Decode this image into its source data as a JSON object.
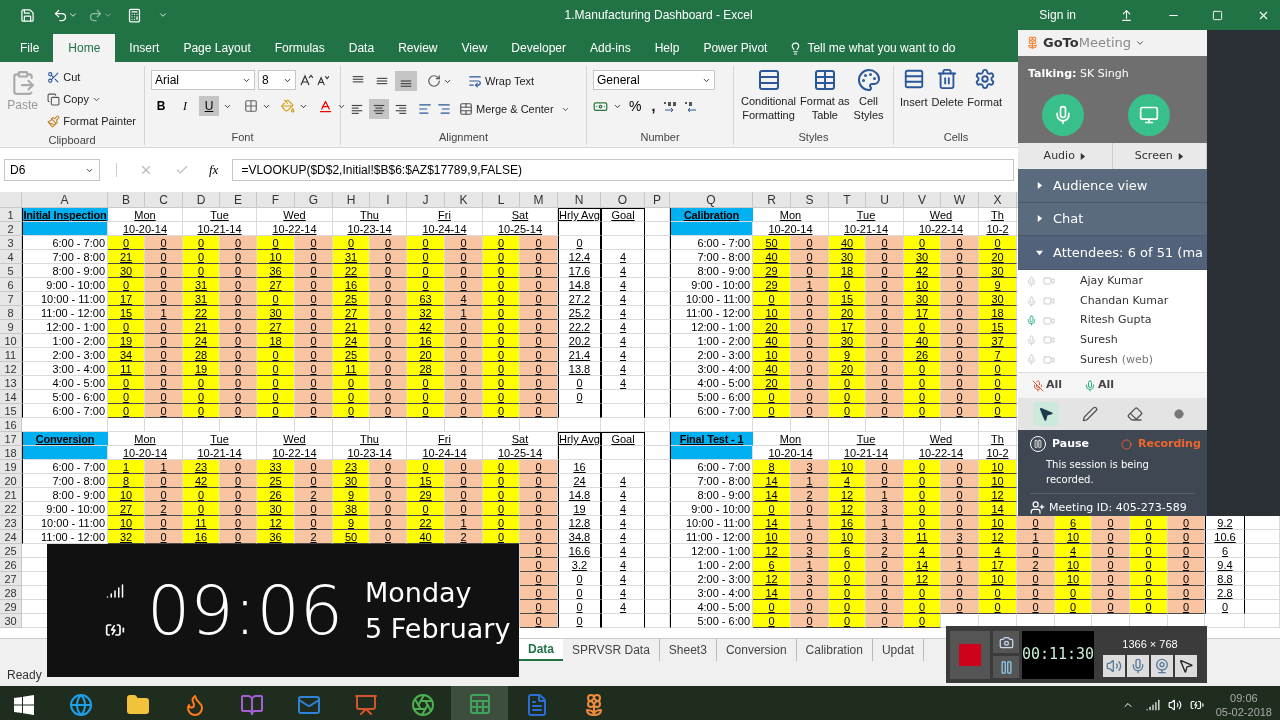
{
  "title_bar": {
    "title": "1.Manufacturing Dashboard  -  Excel",
    "sign_in": "Sign in"
  },
  "ribbon_tabs": [
    {
      "label": "File",
      "selected": false
    },
    {
      "label": "Home",
      "selected": true
    },
    {
      "label": "Insert",
      "selected": false
    },
    {
      "label": "Page Layout",
      "selected": false
    },
    {
      "label": "Formulas",
      "selected": false
    },
    {
      "label": "Data",
      "selected": false
    },
    {
      "label": "Review",
      "selected": false
    },
    {
      "label": "View",
      "selected": false
    },
    {
      "label": "Developer",
      "selected": false
    },
    {
      "label": "Add-ins",
      "selected": false
    },
    {
      "label": "Help",
      "selected": false
    },
    {
      "label": "Power Pivot",
      "selected": false
    }
  ],
  "tell_me": "Tell me what you want to do",
  "ribbon": {
    "clipboard": {
      "paste": "Paste",
      "cut": "Cut",
      "copy": "Copy",
      "format_painter": "Format Painter",
      "label": "Clipboard"
    },
    "font": {
      "name": "Arial",
      "size": "8",
      "buttons": [
        {
          "label": "B",
          "on": false
        },
        {
          "label": "I",
          "on": false
        },
        {
          "label": "U",
          "on": true
        }
      ],
      "label": "Font"
    },
    "alignment": {
      "buttons": [
        {
          "kind": "top",
          "on": false
        },
        {
          "kind": "middle",
          "on": false
        },
        {
          "kind": "bottom",
          "on": true
        },
        {
          "kind": "left",
          "on": false
        },
        {
          "kind": "center",
          "on": true
        },
        {
          "kind": "right",
          "on": false
        }
      ],
      "wrap_text": "Wrap Text",
      "merge_center": "Merge & Center",
      "label": "Alignment"
    },
    "number": {
      "format": "General",
      "percent": "%",
      "comma": ",",
      "label": "Number"
    },
    "styles": {
      "buttons": [
        {
          "kind": "conditional",
          "lines": [
            "Conditional",
            "Formatting"
          ]
        },
        {
          "kind": "table",
          "lines": [
            "Format as",
            "Table"
          ]
        },
        {
          "kind": "cell",
          "lines": [
            "Cell",
            "Styles"
          ]
        }
      ],
      "label": "Styles"
    },
    "cells": {
      "buttons": [
        {
          "kind": "insert",
          "label": "Insert"
        },
        {
          "kind": "delete",
          "label": "Delete"
        },
        {
          "kind": "format",
          "label": "Format"
        }
      ],
      "label": "Cells"
    }
  },
  "formula_bar": {
    "name_box": "D6",
    "fx": "fx",
    "formula": "=VLOOKUP($D$2,Initial!$B$6:$AZ$17789,9,FALSE)"
  },
  "sheet": {
    "column_headers": [
      "A",
      "B",
      "C",
      "D",
      "E",
      "F",
      "G",
      "H",
      "I",
      "J",
      "K",
      "L",
      "M",
      "N",
      "O",
      "P",
      "Q",
      "R",
      "S",
      "T",
      "U",
      "V",
      "W",
      "X"
    ],
    "row_numbers": [
      "1",
      "2",
      "3",
      "4",
      "5",
      "6",
      "7",
      "8",
      "9",
      "10",
      "11",
      "12",
      "13",
      "14",
      "15",
      "16",
      "17",
      "18",
      "19",
      "20",
      "21",
      "22",
      "23",
      "24",
      "25",
      "26",
      "27",
      "28",
      "29",
      "30"
    ],
    "tables": [
      {
        "title": "Initial Inspection",
        "days": [
          {
            "day": "Mon",
            "date": "10-20-14"
          },
          {
            "day": "Tue",
            "date": "10-21-14"
          },
          {
            "day": "Wed",
            "date": "10-22-14"
          },
          {
            "day": "Thu",
            "date": "10-23-14"
          },
          {
            "day": "Fri",
            "date": "10-24-14"
          },
          {
            "day": "Sat",
            "date": "10-25-14"
          }
        ],
        "hourly_avg_label": "Hrly Avg",
        "goal_label": "Goal",
        "rows": [
          {
            "time": "6:00 - 7:00",
            "values": [
              "0",
              "0",
              "0",
              "0",
              "0",
              "0",
              "0",
              "0",
              "0",
              "0",
              "0",
              "0"
            ],
            "hrly_avg": "0"
          },
          {
            "time": "7:00 - 8:00",
            "values": [
              "21",
              "0",
              "0",
              "0",
              "10",
              "0",
              "31",
              "0",
              "0",
              "0",
              "0",
              "0"
            ],
            "hrly_avg": "12.4",
            "goal": "4"
          },
          {
            "time": "8:00 - 9:00",
            "values": [
              "30",
              "0",
              "0",
              "0",
              "36",
              "0",
              "22",
              "0",
              "0",
              "0",
              "0",
              "0"
            ],
            "hrly_avg": "17.6",
            "goal": "4"
          },
          {
            "time": "9:00 - 10:00",
            "values": [
              "0",
              "0",
              "31",
              "0",
              "27",
              "0",
              "16",
              "0",
              "0",
              "0",
              "0",
              "0"
            ],
            "hrly_avg": "14.8",
            "goal": "4"
          },
          {
            "time": "10:00 - 11:00",
            "values": [
              "17",
              "0",
              "31",
              "0",
              "0",
              "0",
              "25",
              "0",
              "63",
              "4",
              "0",
              "0"
            ],
            "hrly_avg": "27.2",
            "goal": "4"
          },
          {
            "time": "11:00 - 12:00",
            "values": [
              "15",
              "1",
              "22",
              "0",
              "30",
              "0",
              "27",
              "0",
              "32",
              "1",
              "0",
              "0"
            ],
            "hrly_avg": "25.2",
            "goal": "4"
          },
          {
            "time": "12:00 - 1:00",
            "values": [
              "0",
              "0",
              "21",
              "0",
              "27",
              "0",
              "21",
              "0",
              "42",
              "0",
              "0",
              "0"
            ],
            "hrly_avg": "22.2",
            "goal": "4"
          },
          {
            "time": "1:00 - 2:00",
            "values": [
              "19",
              "0",
              "24",
              "0",
              "18",
              "0",
              "24",
              "0",
              "16",
              "0",
              "0",
              "0"
            ],
            "hrly_avg": "20.2",
            "goal": "4"
          },
          {
            "time": "2:00 - 3:00",
            "values": [
              "34",
              "0",
              "28",
              "0",
              "0",
              "0",
              "25",
              "0",
              "20",
              "0",
              "0",
              "0"
            ],
            "hrly_avg": "21.4",
            "goal": "4"
          },
          {
            "time": "3:00 - 4:00",
            "values": [
              "11",
              "0",
              "19",
              "0",
              "0",
              "0",
              "11",
              "0",
              "28",
              "0",
              "0",
              "0"
            ],
            "hrly_avg": "13.8",
            "goal": "4"
          },
          {
            "time": "4:00 - 5:00",
            "values": [
              "0",
              "0",
              "0",
              "0",
              "0",
              "0",
              "0",
              "0",
              "0",
              "0",
              "0",
              "0"
            ],
            "hrly_avg": "0",
            "goal": "4"
          },
          {
            "time": "5:00 - 6:00",
            "values": [
              "0",
              "0",
              "0",
              "0",
              "0",
              "0",
              "0",
              "0",
              "0",
              "0",
              "0",
              "0"
            ],
            "hrly_avg": "0"
          },
          {
            "time": "6:00 - 7:00",
            "values": [
              "0",
              "0",
              "0",
              "0",
              "0",
              "0",
              "0",
              "0",
              "0",
              "0",
              "0",
              "0"
            ]
          }
        ]
      },
      {
        "title": "Conversion",
        "days": [
          {
            "day": "Mon",
            "date": "10-20-14"
          },
          {
            "day": "Tue",
            "date": "10-21-14"
          },
          {
            "day": "Wed",
            "date": "10-22-14"
          },
          {
            "day": "Thu",
            "date": "10-23-14"
          },
          {
            "day": "Fri",
            "date": "10-24-14"
          },
          {
            "day": "Sat",
            "date": "10-25-14"
          }
        ],
        "hourly_avg_label": "Hrly Avg",
        "goal_label": "Goal",
        "rows": [
          {
            "time": "6:00 - 7:00",
            "values": [
              "1",
              "1",
              "23",
              "0",
              "33",
              "0",
              "23",
              "0",
              "0",
              "0",
              "0",
              "0"
            ],
            "hrly_avg": "16"
          },
          {
            "time": "7:00 - 8:00",
            "values": [
              "8",
              "0",
              "42",
              "0",
              "25",
              "0",
              "30",
              "0",
              "15",
              "0",
              "0",
              "0"
            ],
            "hrly_avg": "24",
            "goal": "4"
          },
          {
            "time": "8:00 - 9:00",
            "values": [
              "10",
              "0",
              "0",
              "0",
              "26",
              "2",
              "9",
              "0",
              "29",
              "0",
              "0",
              "0"
            ],
            "hrly_avg": "14.8",
            "goal": "4"
          },
          {
            "time": "9:00 - 10:00",
            "values": [
              "27",
              "2",
              "0",
              "0",
              "30",
              "0",
              "38",
              "0",
              "0",
              "0",
              "0",
              "0"
            ],
            "hrly_avg": "19",
            "goal": "4"
          },
          {
            "time": "10:00 - 11:00",
            "values": [
              "10",
              "0",
              "11",
              "0",
              "12",
              "0",
              "9",
              "0",
              "22",
              "1",
              "0",
              "0"
            ],
            "hrly_avg": "12.8",
            "goal": "4"
          },
          {
            "time": "11:00 - 12:00",
            "values": [
              "32",
              "0",
              "16",
              "0",
              "36",
              "2",
              "50",
              "0",
              "40",
              "2",
              "0",
              "0"
            ],
            "hrly_avg": "34.8",
            "goal": "4"
          },
          {
            "values": [
              "0"
            ],
            "hrly_avg": "16.6",
            "goal": "4"
          },
          {
            "values": [
              "0"
            ],
            "hrly_avg": "3.2",
            "goal": "4"
          },
          {
            "values": [
              "0"
            ],
            "hrly_avg": "0",
            "goal": "4"
          },
          {
            "values": [
              "0"
            ],
            "hrly_avg": "0",
            "goal": "4"
          },
          {
            "values": [
              "0"
            ],
            "hrly_avg": "0",
            "goal": "4"
          },
          {
            "values": [
              "0"
            ],
            "hrly_avg": "0"
          }
        ]
      },
      {
        "title": "Calibration",
        "days": [
          {
            "day": "Mon",
            "date": "10-20-14"
          },
          {
            "day": "Tue",
            "date": "10-21-14"
          },
          {
            "day": "Wed",
            "date": "10-22-14"
          },
          {
            "day": "Th",
            "date": "10-2"
          }
        ],
        "rows": [
          {
            "time": "6:00 - 7:00",
            "values": [
              "50",
              "0",
              "40",
              "0",
              "0",
              "0",
              "0"
            ]
          },
          {
            "time": "7:00 - 8:00",
            "values": [
              "40",
              "0",
              "30",
              "0",
              "30",
              "0",
              "20"
            ]
          },
          {
            "time": "8:00 - 9:00",
            "values": [
              "29",
              "0",
              "18",
              "0",
              "42",
              "0",
              "30"
            ]
          },
          {
            "time": "9:00 - 10:00",
            "values": [
              "29",
              "1",
              "0",
              "0",
              "10",
              "0",
              "9"
            ]
          },
          {
            "time": "10:00 - 11:00",
            "values": [
              "0",
              "0",
              "15",
              "0",
              "30",
              "0",
              "30"
            ]
          },
          {
            "time": "11:00 - 12:00",
            "values": [
              "10",
              "0",
              "20",
              "0",
              "17",
              "0",
              "18"
            ]
          },
          {
            "time": "12:00 - 1:00",
            "values": [
              "20",
              "0",
              "17",
              "0",
              "0",
              "0",
              "15"
            ]
          },
          {
            "time": "1:00 - 2:00",
            "values": [
              "40",
              "0",
              "30",
              "0",
              "40",
              "0",
              "37"
            ]
          },
          {
            "time": "2:00 - 3:00",
            "values": [
              "10",
              "0",
              "9",
              "0",
              "26",
              "0",
              "7"
            ]
          },
          {
            "time": "3:00 - 4:00",
            "values": [
              "40",
              "0",
              "20",
              "0",
              "0",
              "0",
              "0"
            ]
          },
          {
            "time": "4:00 - 5:00",
            "values": [
              "20",
              "0",
              "0",
              "0",
              "0",
              "0",
              "0"
            ]
          },
          {
            "time": "5:00 - 6:00",
            "values": [
              "0",
              "0",
              "0",
              "0",
              "0",
              "0",
              "0"
            ]
          },
          {
            "time": "6:00 - 7:00",
            "values": [
              "0",
              "0",
              "0",
              "0",
              "0",
              "0",
              "0"
            ]
          }
        ]
      },
      {
        "title": "Final Test - 1",
        "days": [
          {
            "day": "Mon",
            "date": "10-20-14"
          },
          {
            "day": "Tue",
            "date": "10-21-14"
          },
          {
            "day": "Wed",
            "date": "10-22-14"
          },
          {
            "day": "Th",
            "date": "10-2"
          }
        ],
        "rows": [
          {
            "time": "6:00 - 7:00",
            "values": [
              "8",
              "3",
              "10",
              "0",
              "0",
              "0",
              "10"
            ]
          },
          {
            "time": "7:00 - 8:00",
            "values": [
              "14",
              "1",
              "4",
              "0",
              "0",
              "0",
              "10"
            ]
          },
          {
            "time": "8:00 - 9:00",
            "values": [
              "14",
              "2",
              "12",
              "1",
              "0",
              "0",
              "12"
            ]
          },
          {
            "time": "9:00 - 10:00",
            "values": [
              "0",
              "0",
              "12",
              "3",
              "0",
              "0",
              "14"
            ]
          },
          {
            "time": "10:00 - 11:00",
            "values": [
              "14",
              "1",
              "16",
              "1",
              "0",
              "0",
              "10",
              "0",
              "6",
              "0",
              "0",
              "0"
            ],
            "hrly_avg": "9.2"
          },
          {
            "time": "11:00 - 12:00",
            "values": [
              "10",
              "0",
              "10",
              "3",
              "11",
              "3",
              "12",
              "1",
              "10",
              "0",
              "0",
              "0"
            ],
            "hrly_avg": "10.6"
          },
          {
            "time": "12:00 - 1:00",
            "values": [
              "12",
              "3",
              "6",
              "2",
              "4",
              "0",
              "4",
              "0",
              "4",
              "0",
              "0",
              "0"
            ],
            "hrly_avg": "6"
          },
          {
            "time": "1:00 - 2:00",
            "values": [
              "6",
              "1",
              "0",
              "0",
              "14",
              "1",
              "17",
              "2",
              "10",
              "0",
              "0",
              "0"
            ],
            "hrly_avg": "9.4"
          },
          {
            "time": "2:00 - 3:00",
            "values": [
              "12",
              "3",
              "0",
              "0",
              "12",
              "0",
              "10",
              "0",
              "10",
              "0",
              "0",
              "0"
            ],
            "hrly_avg": "8.8"
          },
          {
            "time": "3:00 - 4:00",
            "values": [
              "14",
              "0",
              "0",
              "0",
              "0",
              "0",
              "0",
              "0",
              "0",
              "0",
              "0",
              "0"
            ],
            "hrly_avg": "2.8"
          },
          {
            "time": "4:00 - 5:00",
            "values": [
              "0",
              "0",
              "0",
              "0",
              "0",
              "0",
              "0",
              "0",
              "0",
              "0",
              "0",
              "0"
            ],
            "hrly_avg": "0"
          },
          {
            "time": "5:00 - 6:00",
            "values": [
              "0",
              "0",
              "0",
              "0",
              "0"
            ]
          }
        ]
      }
    ]
  },
  "sheet_tabs": [
    {
      "label": "Data",
      "selected": true
    },
    {
      "label": "SPRVSR Data",
      "selected": false
    },
    {
      "label": "Sheet3",
      "selected": false
    },
    {
      "label": "Conversion",
      "selected": false
    },
    {
      "label": "Calibration",
      "selected": false
    },
    {
      "label": "Updat",
      "selected": false
    }
  ],
  "status_bar": {
    "mode": "Ready"
  },
  "lock_overlay": {
    "time": "09:06",
    "day": "Monday",
    "date": "5 February"
  },
  "taskbar": {
    "apps": [
      {
        "kind": "browser",
        "selected": false
      },
      {
        "kind": "folder",
        "selected": false
      },
      {
        "kind": "firefox",
        "selected": false
      },
      {
        "kind": "notebook",
        "selected": false
      },
      {
        "kind": "mail",
        "selected": false
      },
      {
        "kind": "slides",
        "selected": false
      },
      {
        "kind": "chrome",
        "selected": false
      },
      {
        "kind": "sheet",
        "selected": true
      },
      {
        "kind": "document",
        "selected": false
      },
      {
        "kind": "flower",
        "selected": false
      }
    ],
    "time": "09:06",
    "date": "05-02-2018"
  },
  "meeting": {
    "brand_bold": "GoTo",
    "brand_light": "Meeting",
    "talking_label": "Talking:",
    "talking_name": "SK Singh",
    "tabs": [
      "Audio",
      "Screen"
    ],
    "sections": [
      {
        "label": "Audience view",
        "expanded": false
      },
      {
        "label": "Chat",
        "expanded": false
      },
      {
        "label": "Attendees:  6 of 51 (ma",
        "expanded": true
      }
    ],
    "attendees": [
      {
        "name": "Ajay Kumar",
        "mic_active": false
      },
      {
        "name": "Chandan Kumar",
        "mic_active": false
      },
      {
        "name": "Ritesh Gupta",
        "mic_active": true
      },
      {
        "name": "Suresh",
        "mic_active": false
      },
      {
        "name": "Suresh",
        "note": "(web)",
        "mic_active": false
      }
    ],
    "all_buttons": [
      {
        "kind": "mute",
        "label": "All"
      },
      {
        "kind": "unmute",
        "label": "All"
      }
    ],
    "tools": [
      {
        "kind": "pointer",
        "selected": true
      },
      {
        "kind": "pen",
        "selected": false
      },
      {
        "kind": "eraser",
        "selected": false
      },
      {
        "kind": "spotlight",
        "selected": false
      }
    ],
    "pause": "Pause",
    "recording": "Recording",
    "recorded_note": "This session is being recorded.",
    "meeting_id": "Meeting ID: 405-273-589"
  },
  "recorder": {
    "timer": "00:11:30",
    "resolution": "1366 × 768"
  }
}
